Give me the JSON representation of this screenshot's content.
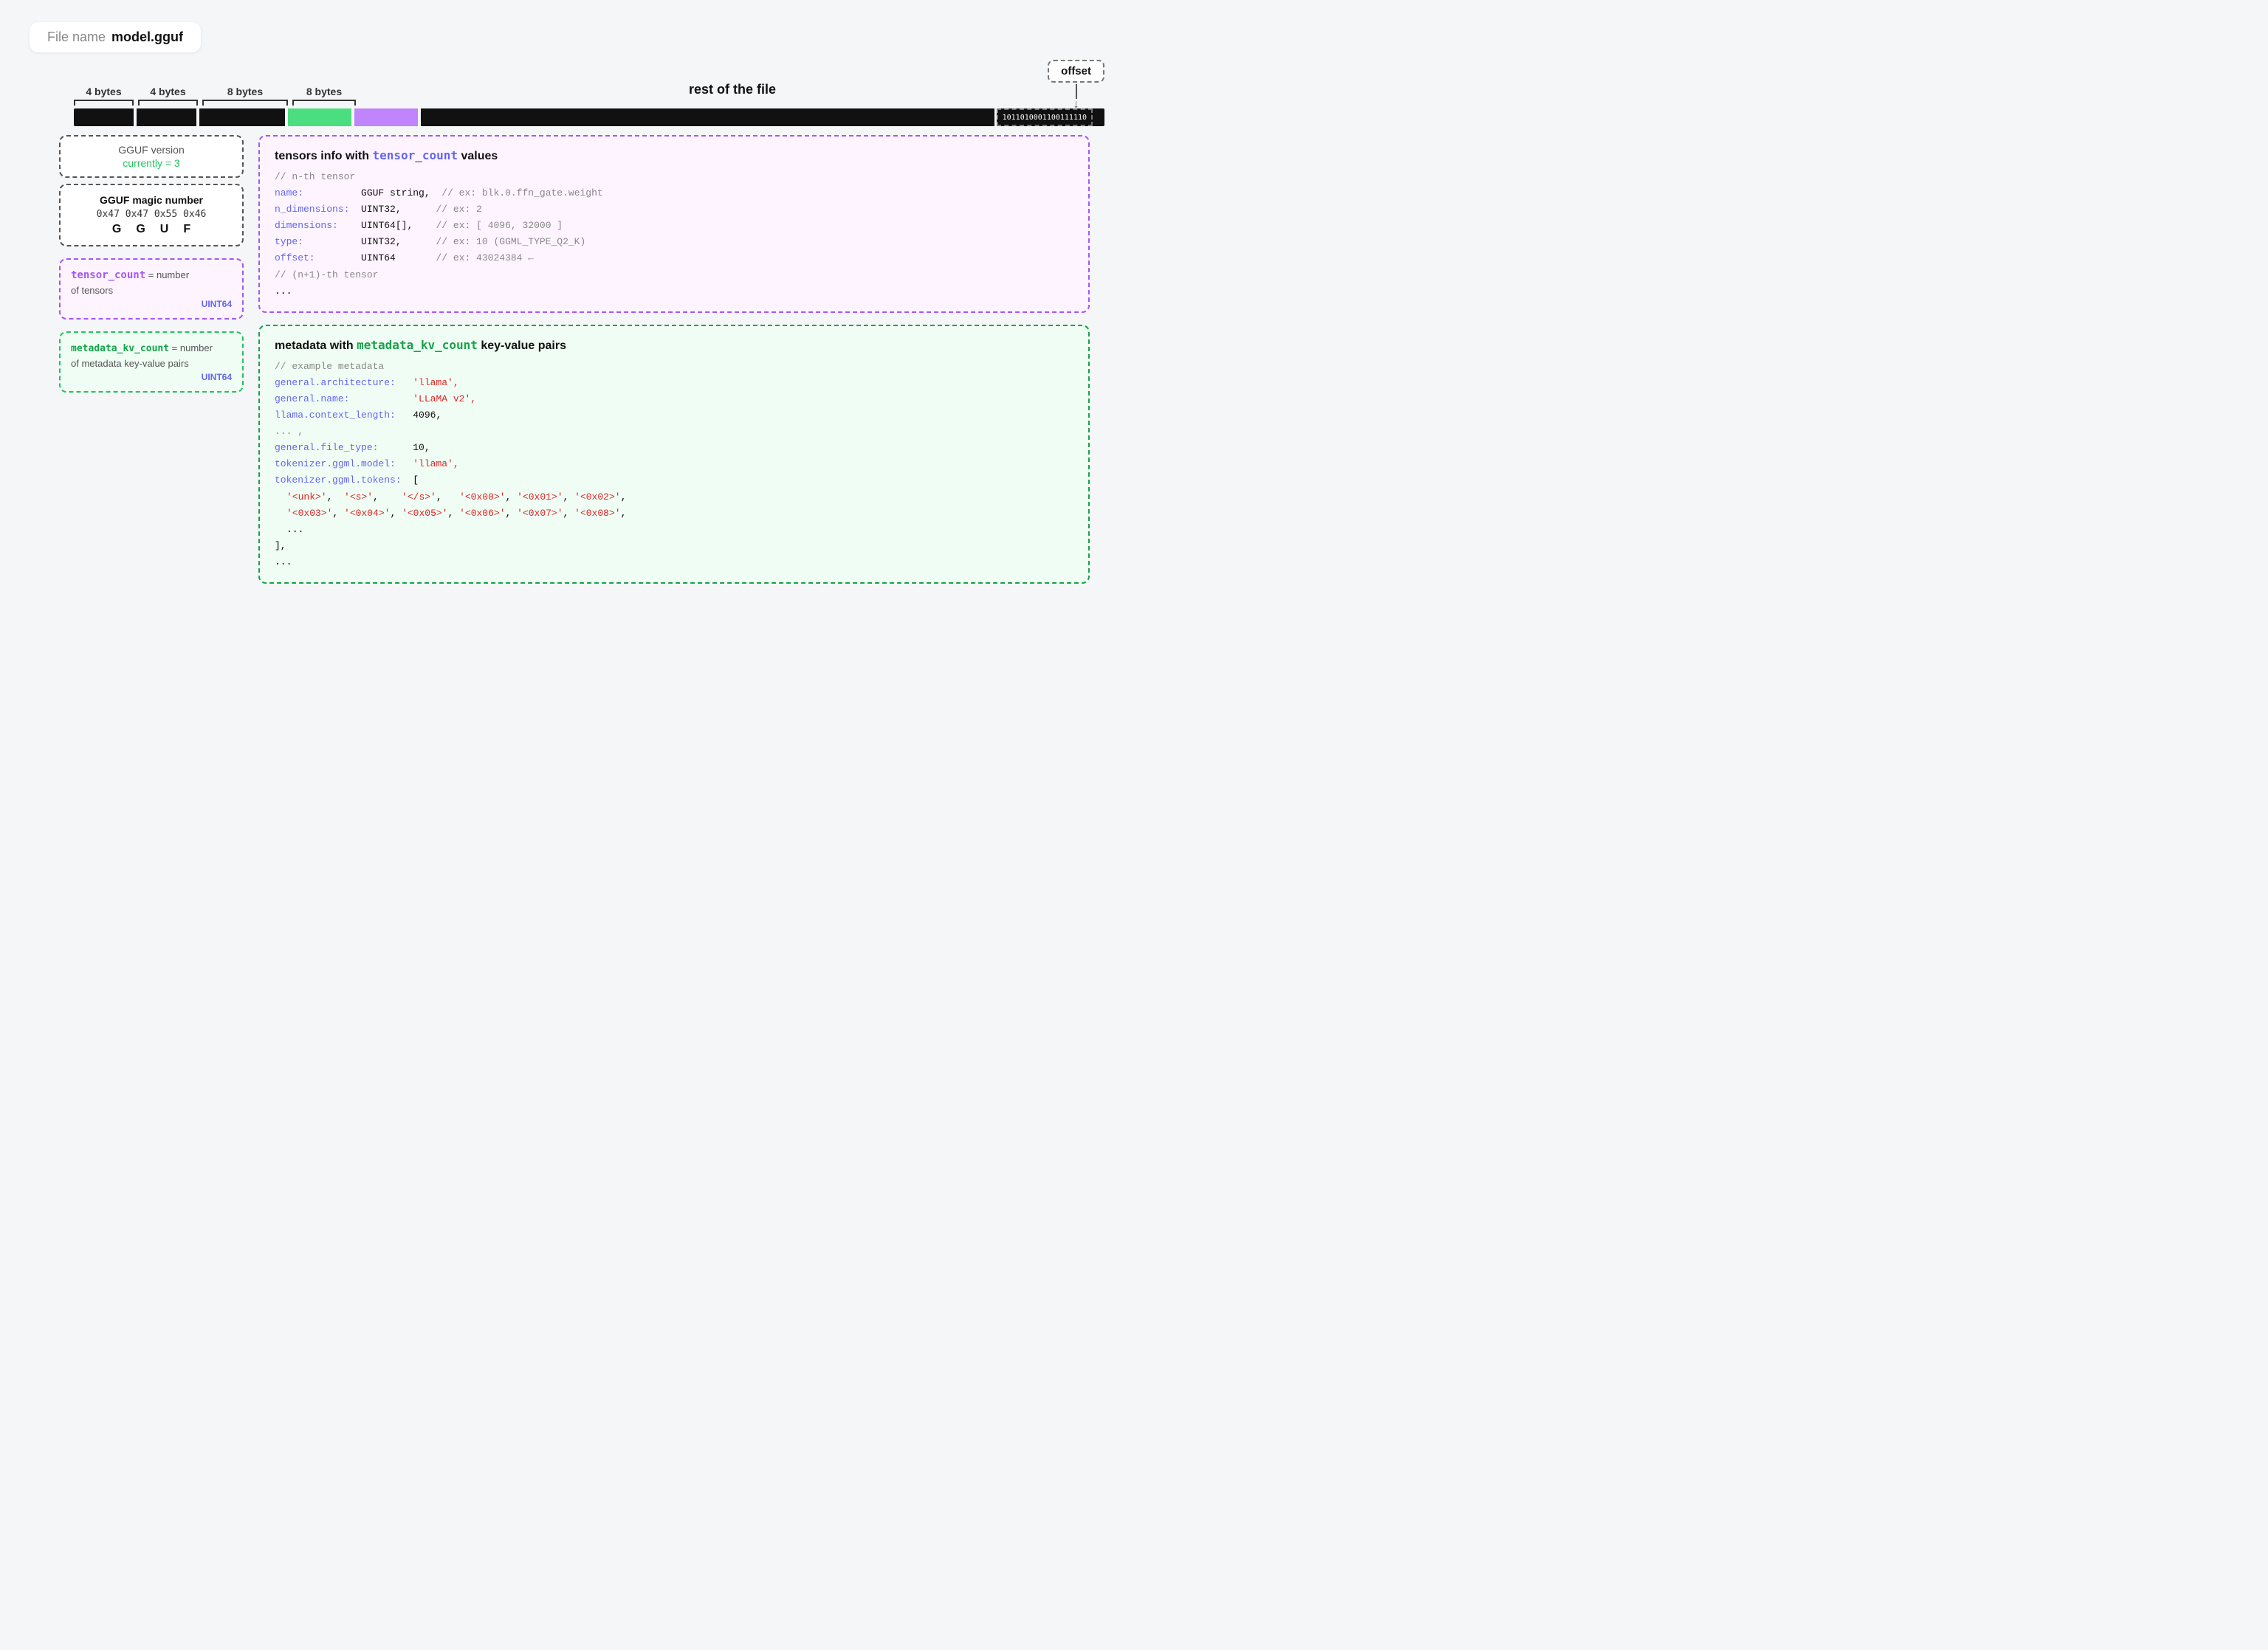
{
  "header": {
    "file_label": "File name",
    "file_name": "model.gguf"
  },
  "byte_labels": {
    "b1": "4 bytes",
    "b2": "4 bytes",
    "b3": "8 bytes",
    "b4": "8 bytes",
    "rest": "rest of the file"
  },
  "binary_text": "1011010001100111110",
  "offset_label": "offset",
  "left_boxes": {
    "magic": {
      "title": "GGUF magic number",
      "hex": "0x47 0x47 0x55 0x46",
      "chars": [
        "G",
        "G",
        "U",
        "F"
      ]
    },
    "version": {
      "label": "GGUF version",
      "currently": "currently = 3"
    },
    "tensor_count": {
      "name": "tensor_count",
      "equals": " = number",
      "desc": "of tensors",
      "type": "UINT64"
    },
    "metadata_kv_count": {
      "name": "metadata_kv_count",
      "equals": " = number",
      "desc": "of metadata key-value pairs",
      "type": "UINT64"
    }
  },
  "tensors_box": {
    "title_prefix": "tensors info with ",
    "title_var": "tensor_count",
    "title_suffix": " values",
    "comment1": "// n-th tensor",
    "rows": [
      {
        "key": "name:",
        "type": "GGUF string,",
        "comment": "// ex: blk.0.ffn_gate.weight"
      },
      {
        "key": "n_dimensions:",
        "type": "UINT32,",
        "comment": "// ex: 2"
      },
      {
        "key": "dimensions:",
        "type": "UINT64[],",
        "comment": "// ex: [ 4096, 32000 ]"
      },
      {
        "key": "type:",
        "type": "UINT32,",
        "comment": "// ex: 10 (GGML_TYPE_Q2_K)"
      },
      {
        "key": "offset:",
        "type": "UINT64",
        "comment": "// ex: 43024384 ←"
      }
    ],
    "comment2": "// (n+1)-th tensor",
    "ellipsis": "..."
  },
  "metadata_box": {
    "title_prefix": "metadata with ",
    "title_var": "metadata_kv_count",
    "title_suffix": " key-value pairs",
    "comment1": "// example metadata",
    "lines": [
      {
        "key": "general.architecture:",
        "value": "'llama',"
      },
      {
        "key": "general.name:",
        "value": "'LLaMA v2',"
      },
      {
        "key": "llama.context_length:",
        "value": "4096,"
      },
      {
        "key": "... ,",
        "value": ""
      },
      {
        "key": "general.file_type:",
        "value": "10,"
      },
      {
        "key": "tokenizer.ggml.model:",
        "value": "'llama',"
      },
      {
        "key": "tokenizer.ggml.tokens:",
        "value": "["
      }
    ],
    "tokens_row": "  '<unk>',  '<s>',    '</s>',   '<0x00>', '<0x01>', '<0x02>',",
    "tokens_row2": "  '<0x03>', '<0x04>', '<0x05>', '<0x06>', '<0x07>', '<0x08>',",
    "tokens_ellipsis": "  ...",
    "close_bracket": "],",
    "final_ellipsis": "..."
  }
}
